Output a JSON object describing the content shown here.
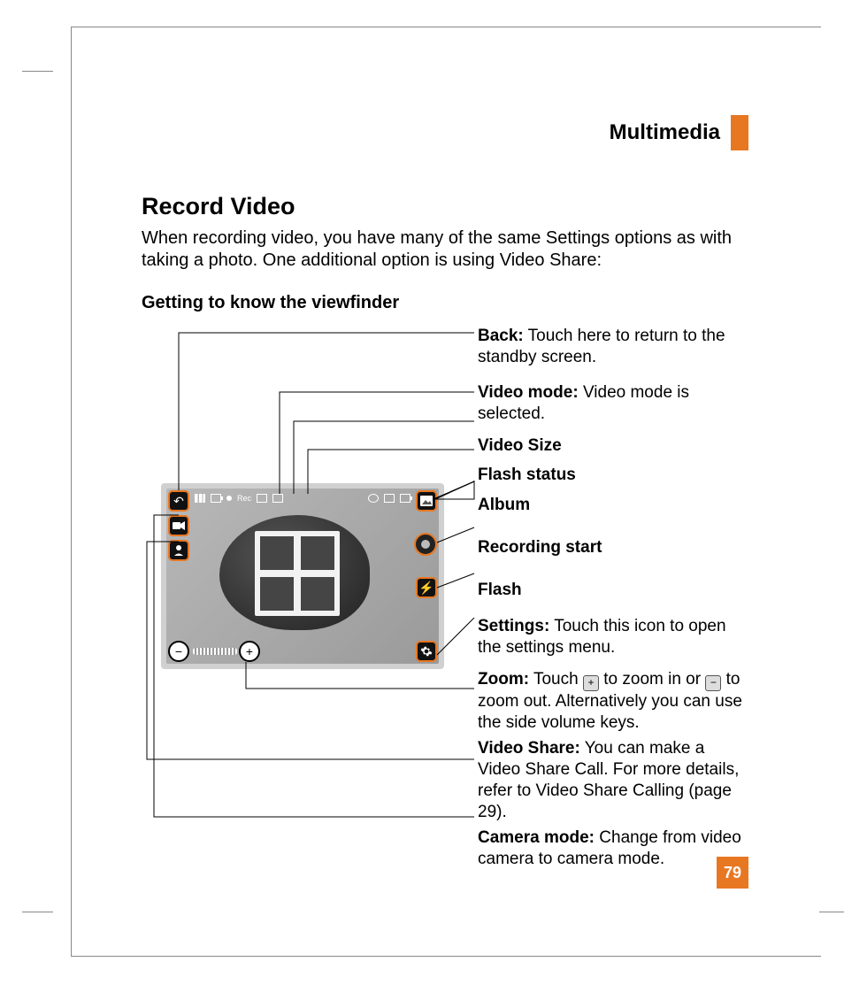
{
  "header": {
    "section": "Multimedia"
  },
  "page": {
    "number": "79"
  },
  "title": "Record Video",
  "intro": "When recording video, you have many of the same Settings options as with taking a photo. One additional option is using Video Share:",
  "subhead": "Getting to know the viewfinder",
  "status": {
    "rec_label": "Rec"
  },
  "callouts": {
    "back": {
      "label": "Back:",
      "text": " Touch here to return to the standby screen."
    },
    "vmode": {
      "label": "Video mode:",
      "text": " Video mode is selected."
    },
    "vsize": {
      "label": "Video Size",
      "text": ""
    },
    "flashst": {
      "label": "Flash status",
      "text": ""
    },
    "album": {
      "label": "Album",
      "text": ""
    },
    "recstart": {
      "label": "Recording start",
      "text": ""
    },
    "flash": {
      "label": "Flash",
      "text": ""
    },
    "settings": {
      "label": "Settings:",
      "text": " Touch this icon to open the settings menu."
    },
    "zoom": {
      "label": "Zoom:",
      "pre": " Touch ",
      "mid": " to zoom in or ",
      "post": " to zoom out. Alternatively you can use the side volume keys."
    },
    "vshare": {
      "label": "Video Share:",
      "text": " You can make a Video Share Call. For more details, refer to Video Share Calling (page 29)."
    },
    "cammode": {
      "label": "Camera mode:",
      "text": " Change from video camera to camera mode."
    }
  }
}
